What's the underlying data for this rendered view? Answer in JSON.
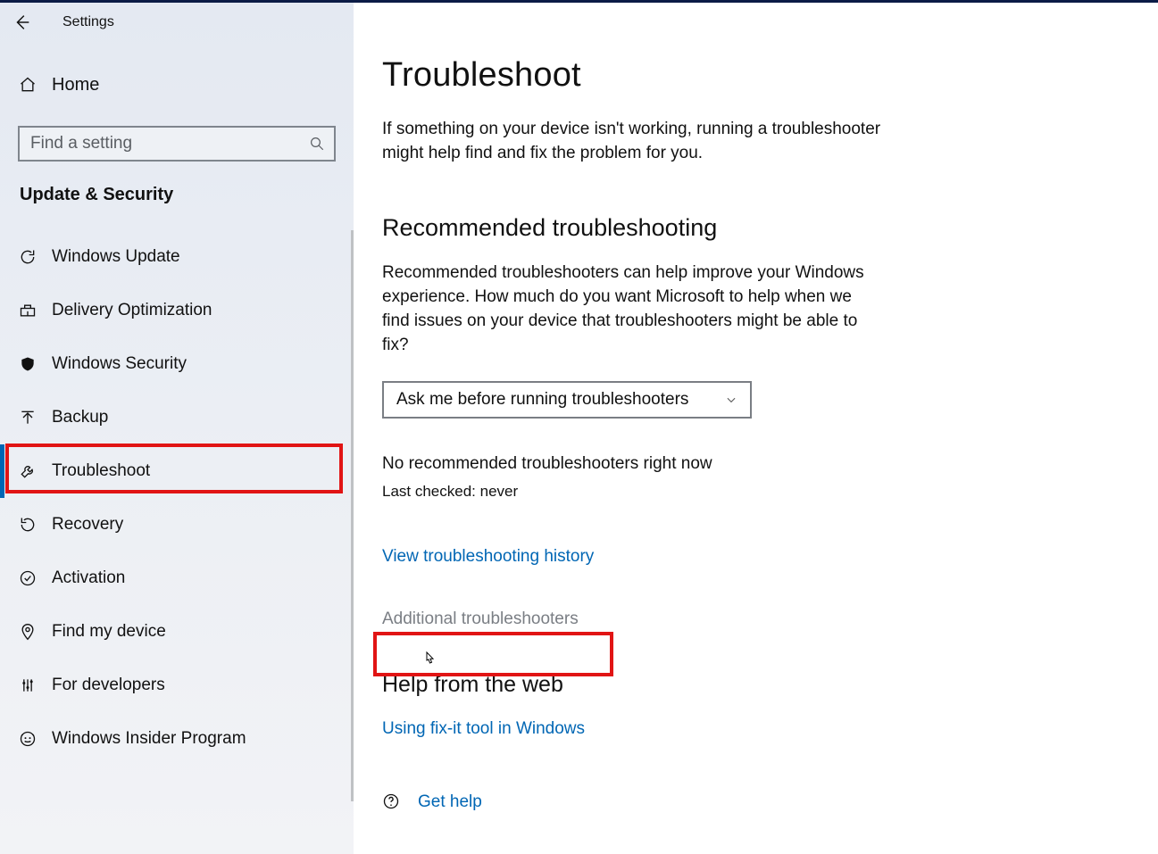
{
  "window": {
    "title": "Settings"
  },
  "sidebar": {
    "home_label": "Home",
    "search_placeholder": "Find a setting",
    "section_title": "Update & Security",
    "items": [
      {
        "label": "Windows Update"
      },
      {
        "label": "Delivery Optimization"
      },
      {
        "label": "Windows Security"
      },
      {
        "label": "Backup"
      },
      {
        "label": "Troubleshoot"
      },
      {
        "label": "Recovery"
      },
      {
        "label": "Activation"
      },
      {
        "label": "Find my device"
      },
      {
        "label": "For developers"
      },
      {
        "label": "Windows Insider Program"
      }
    ]
  },
  "main": {
    "title": "Troubleshoot",
    "intro": "If something on your device isn't working, running a troubleshooter might help find and fix the problem for you.",
    "recommended_heading": "Recommended troubleshooting",
    "recommended_body": "Recommended troubleshooters can help improve your Windows experience. How much do you want Microsoft to help when we find issues on your device that troubleshooters might be able to fix?",
    "dropdown_value": "Ask me before running troubleshooters",
    "status": "No recommended troubleshooters right now",
    "last_checked": "Last checked: never",
    "history_link": "View troubleshooting history",
    "additional_link": "Additional troubleshooters",
    "help_heading": "Help from the web",
    "help_link": "Using fix-it tool in Windows",
    "get_help": "Get help"
  }
}
